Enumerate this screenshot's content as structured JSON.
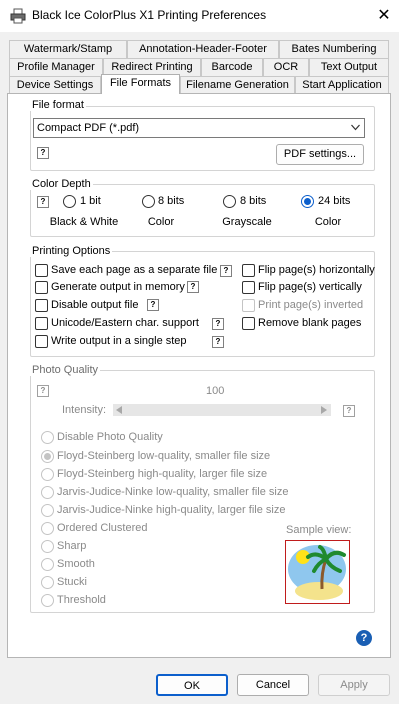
{
  "window": {
    "title": "Black Ice ColorPlus X1 Printing Preferences",
    "close_glyph": "✕",
    "app_icon": "printer-icon"
  },
  "tabs": {
    "row1": [
      "Watermark/Stamp",
      "Annotation-Header-Footer",
      "Bates Numbering"
    ],
    "row2": [
      "Profile Manager",
      "Redirect Printing",
      "Barcode",
      "OCR",
      "Text Output"
    ],
    "row3": [
      "Device Settings",
      "File Formats",
      "Filename Generation",
      "Start Application"
    ],
    "active": "File Formats"
  },
  "file_format": {
    "title": "File format",
    "selected": "Compact PDF (*.pdf)",
    "help": "?",
    "pdf_settings_button": "PDF settings..."
  },
  "color_depth": {
    "title": "Color Depth",
    "help": "?",
    "options": [
      {
        "label": "1 bit",
        "caption": "Black & White",
        "checked": false
      },
      {
        "label": "8 bits",
        "caption": "Color",
        "checked": false
      },
      {
        "label": "8 bits",
        "caption": "Grayscale",
        "checked": false
      },
      {
        "label": "24 bits",
        "caption": "Color",
        "checked": true
      }
    ]
  },
  "printing_options": {
    "title": "Printing Options",
    "help": "?",
    "left": [
      {
        "label": "Save each page as a separate file",
        "checked": false
      },
      {
        "label": "Generate output in memory",
        "checked": false
      },
      {
        "label": "Disable output file",
        "checked": false
      },
      {
        "label": "Unicode/Eastern char. support",
        "checked": false
      },
      {
        "label": "Write output in a single step",
        "checked": false
      }
    ],
    "right": [
      {
        "label": "Flip page(s) horizontally",
        "checked": false,
        "disabled": false
      },
      {
        "label": "Flip page(s) vertically",
        "checked": false,
        "disabled": false
      },
      {
        "label": "Print page(s) inverted",
        "checked": false,
        "disabled": true
      },
      {
        "label": "Remove blank pages",
        "checked": false,
        "disabled": false
      }
    ]
  },
  "photo_quality": {
    "title": "Photo Quality",
    "help": "?",
    "value": "100",
    "intensity_label": "Intensity:",
    "sample_label": "Sample view:",
    "options": [
      {
        "label": "Disable Photo Quality",
        "checked": false
      },
      {
        "label": "Floyd-Steinberg low-quality, smaller file size",
        "checked": true
      },
      {
        "label": "Floyd-Steinberg high-quality, larger file size",
        "checked": false
      },
      {
        "label": "Jarvis-Judice-Ninke low-quality, smaller file size",
        "checked": false
      },
      {
        "label": "Jarvis-Judice-Ninke high-quality, larger file size",
        "checked": false
      },
      {
        "label": "Ordered Clustered",
        "checked": false
      },
      {
        "label": "Sharp",
        "checked": false
      },
      {
        "label": "Smooth",
        "checked": false
      },
      {
        "label": "Stucki",
        "checked": false
      },
      {
        "label": "Threshold",
        "checked": false
      }
    ]
  },
  "help_icon": "?",
  "buttons": {
    "ok": "OK",
    "cancel": "Cancel",
    "apply": "Apply"
  },
  "colors": {
    "accent": "#0c5fcc",
    "disabled_text": "#8a8a8a",
    "sample_border": "#c01c1c"
  }
}
